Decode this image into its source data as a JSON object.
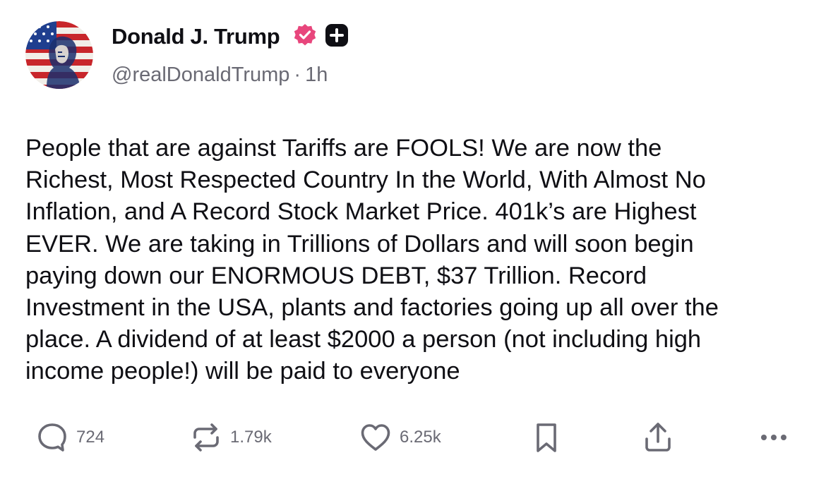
{
  "author": {
    "display_name": "Donald J. Trump",
    "handle": "@realDonaldTrump",
    "separator": "·",
    "time_ago": "1h",
    "avatar_icon": "american-flag-portrait",
    "verified_icon": "verified-badge-icon",
    "plus_icon": "plus-badge-icon"
  },
  "post": {
    "lines": [
      "People that are against Tariffs are FOOLS! We are now the",
      "Richest, Most Respected Country In the World, With Almost No",
      "Inflation, and A Record Stock Market Price. 401k’s are Highest",
      "EVER. We are taking in Trillions of Dollars and will soon begin",
      "paying down our ENORMOUS DEBT, $37 Trillion. Record",
      "Investment in the USA, plants and factories going up all over the",
      "place. A dividend of at least $2000 a person (not including high",
      "income people!) will be paid to everyone"
    ]
  },
  "actions": {
    "replies": "724",
    "reposts": "1.79k",
    "likes": "6.25k",
    "icons": [
      "reply-icon",
      "repost-icon",
      "like-icon",
      "bookmark-icon",
      "share-icon",
      "more-icon"
    ]
  },
  "colors": {
    "text": "#0f0f14",
    "muted": "#6a6a74",
    "verified": "#e8467c",
    "plus_badge": "#0f0f14"
  }
}
